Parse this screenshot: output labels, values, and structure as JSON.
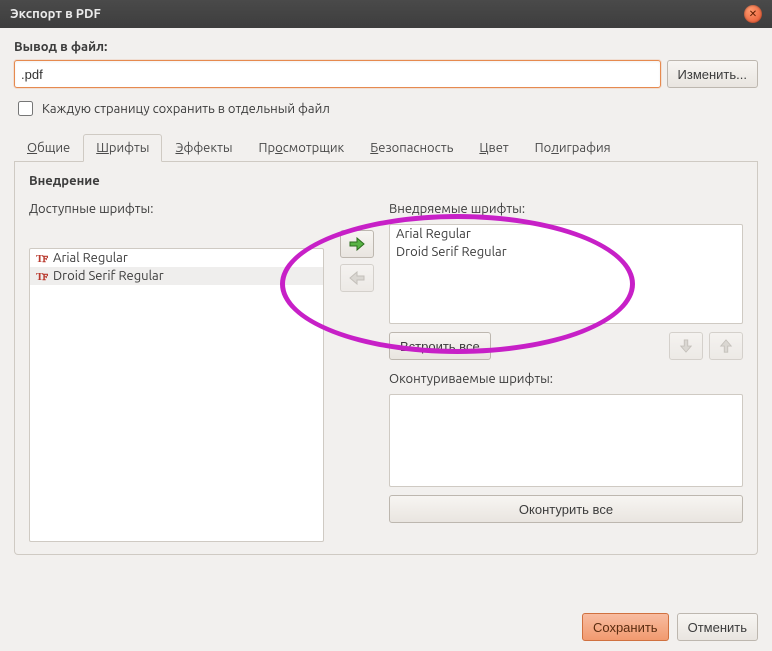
{
  "window": {
    "title": "Экспорт в PDF"
  },
  "output": {
    "label": "Вывод в файл:",
    "file_value": ".pdf",
    "change_button": "Изменить...",
    "split_pages_label": "Каждую страницу сохранить в отдельный файл"
  },
  "tabs": {
    "items": [
      {
        "label_pre": "",
        "ul": "О",
        "label_post": "бщие"
      },
      {
        "label_pre": "",
        "ul": "Ш",
        "label_post": "рифты"
      },
      {
        "label_pre": "",
        "ul": "Э",
        "label_post": "ффекты"
      },
      {
        "label_pre": "Пр",
        "ul": "о",
        "label_post": "смотрщик"
      },
      {
        "label_pre": "",
        "ul": "Б",
        "label_post": "езопасность"
      },
      {
        "label_pre": "",
        "ul": "Ц",
        "label_post": "вет"
      },
      {
        "label_pre": "По",
        "ul": "л",
        "label_post": "играфия"
      }
    ],
    "active_index": 1
  },
  "fonts_panel": {
    "title": "Внедрение",
    "available_label": "Доступные шрифты:",
    "available_fonts": [
      "Arial Regular",
      "Droid Serif Regular"
    ],
    "embed_label": "Внедряемые шрифты:",
    "embedded_fonts": [
      "Arial Regular",
      "Droid Serif Regular"
    ],
    "embed_all_pre": "Встроить вс",
    "embed_all_ul": "е",
    "outline_label": "Оконтуриваемые шрифты:",
    "outline_all": "Оконтурить все"
  },
  "footer": {
    "save": "Сохранить",
    "cancel": "Отменить"
  }
}
